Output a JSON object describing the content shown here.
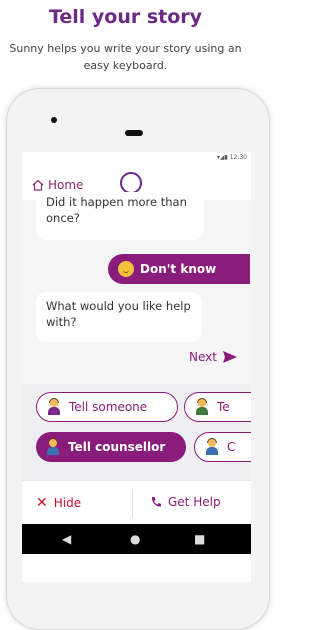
{
  "headline": "Tell your story",
  "subline": "Sunny helps you write your story using an easy keyboard.",
  "status": {
    "time": "12:30"
  },
  "appbar": {
    "home_label": "Home"
  },
  "chat": {
    "bot_message_1": "Did it happen more than once?",
    "user_reply": "Don't know",
    "bot_message_2": "What would you like help with?",
    "next_label": "Next"
  },
  "options": [
    {
      "label": "Tell someone",
      "style": "outline",
      "icon": "person-icon"
    },
    {
      "label": "Te",
      "style": "outline",
      "icon": "person-icon"
    },
    {
      "label": "Tell counsellor",
      "style": "filled",
      "icon": "person-icon"
    },
    {
      "label": "C",
      "style": "outline",
      "icon": "person-icon"
    }
  ],
  "bottom_nav": {
    "hide_label": "Hide",
    "help_label": "Get Help"
  },
  "colors": {
    "brand": "#8a1c7c",
    "headline": "#6a2a86",
    "hide": "#c8102e"
  }
}
